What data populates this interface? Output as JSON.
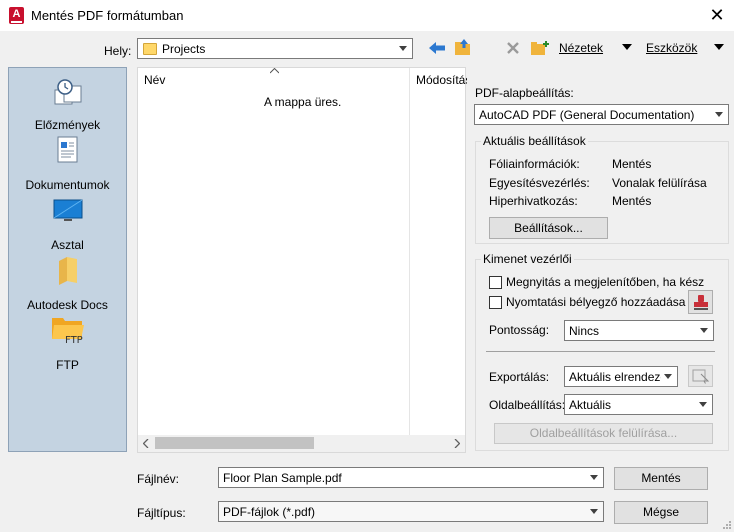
{
  "window": {
    "title": "Mentés PDF formátumban",
    "app_icon_letter": "A",
    "close_glyph": "✕"
  },
  "toolbar": {
    "location_label": "Hely:",
    "location_value": "Projects",
    "views_label": "Nézetek",
    "tools_label": "Eszközök"
  },
  "places": [
    {
      "label": "Előzmények",
      "icon": "history-icon"
    },
    {
      "label": "Dokumentumok",
      "icon": "documents-icon"
    },
    {
      "label": "Asztal",
      "icon": "desktop-icon"
    },
    {
      "label": "Autodesk Docs",
      "icon": "autodesk-docs-folder-icon"
    },
    {
      "label": "FTP",
      "icon": "ftp-folder-icon"
    }
  ],
  "filelist": {
    "col_name": "Név",
    "col_modified": "Módosítás",
    "empty_message": "A mappa üres."
  },
  "pdf": {
    "preset_label": "PDF-alapbeállítás:",
    "preset_value": "AutoCAD PDF (General Documentation)",
    "current_title": "Aktuális beállítások",
    "rows": [
      {
        "key": "Fóliainformációk:",
        "value": "Mentés"
      },
      {
        "key": "Egyesítésvezérlés:",
        "value": "Vonalak felülírása"
      },
      {
        "key": "Hiperhivatkozás:",
        "value": "Mentés"
      }
    ],
    "options_button": "Beállítások...",
    "output_title": "Kimenet vezérlői",
    "open_in_viewer": "Megnyitás a megjelenítőben, ha kész",
    "add_stamp": "Nyomtatási bélyegző hozzáadása",
    "precision_label": "Pontosság:",
    "precision_value": "Nincs",
    "export_label": "Exportálás:",
    "export_value": "Aktuális elrendezés",
    "page_setup_label": "Oldalbeállítás:",
    "page_setup_value": "Aktuális",
    "override_button": "Oldalbeállítások felülírása..."
  },
  "footer": {
    "filename_label": "Fájlnév:",
    "filename_value": "Floor Plan Sample.pdf",
    "filetype_label": "Fájltípus:",
    "filetype_value": "PDF-fájlok (*.pdf)",
    "save_button": "Mentés",
    "cancel_button": "Mégse"
  },
  "colors": {
    "accent_blue": "#2b78d0",
    "places_bg": "#c4d3e1",
    "folder_yellow": "#ffd86a",
    "autodesk_red": "#c8102e"
  }
}
